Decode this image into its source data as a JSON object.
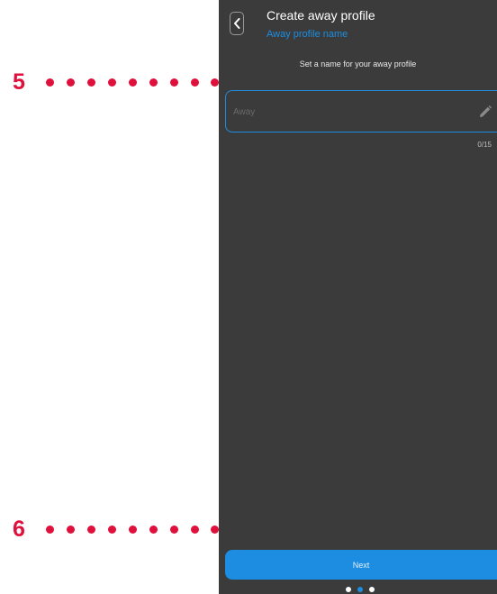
{
  "annotations": [
    {
      "number": "5"
    },
    {
      "number": "6"
    }
  ],
  "header": {
    "back_icon": "chevron-left-icon",
    "title": "Create away profile",
    "subtitle": "Away profile name"
  },
  "form": {
    "prompt": "Set a name for your away profile",
    "name_input": {
      "placeholder": "Away",
      "value": ""
    },
    "edit_icon": "pencil-icon",
    "char_counter": "0/15"
  },
  "footer": {
    "next_label": "Next",
    "pager": {
      "total": 3,
      "active": 2
    }
  },
  "colors": {
    "background": "#3b3b3b",
    "accent": "#1c8de0",
    "callout": "#e0103c"
  }
}
